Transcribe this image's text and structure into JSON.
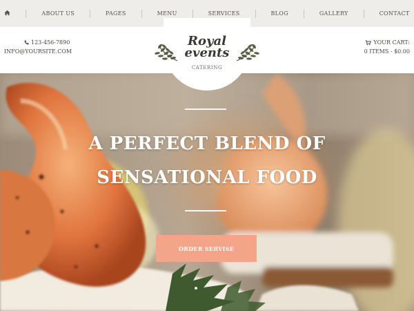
{
  "nav": {
    "home_icon": "home-icon",
    "items": [
      "ABOUT US",
      "PAGES",
      "MENU",
      "SERVICES",
      "BLOG",
      "GALLERY",
      "CONTACT"
    ]
  },
  "contact": {
    "phone_icon": "phone-icon",
    "phone": "123-456-7890",
    "email": "INFO@YOURSITE.COM"
  },
  "logo": {
    "line1": "Royal",
    "line2": "events",
    "subtitle": "CATERING"
  },
  "cart": {
    "icon": "cart-icon",
    "label": "YOUR CART:",
    "summary": "0 ITEMS - $0.00"
  },
  "hero": {
    "title_line1": "A PERFECT BLEND OF",
    "title_line2": "SENSATIONAL FOOD",
    "button_label": "ORDER SERVISE"
  },
  "colors": {
    "nav_bg": "#efedea",
    "accent": "#f4a489",
    "text_dark": "#3b3833"
  }
}
